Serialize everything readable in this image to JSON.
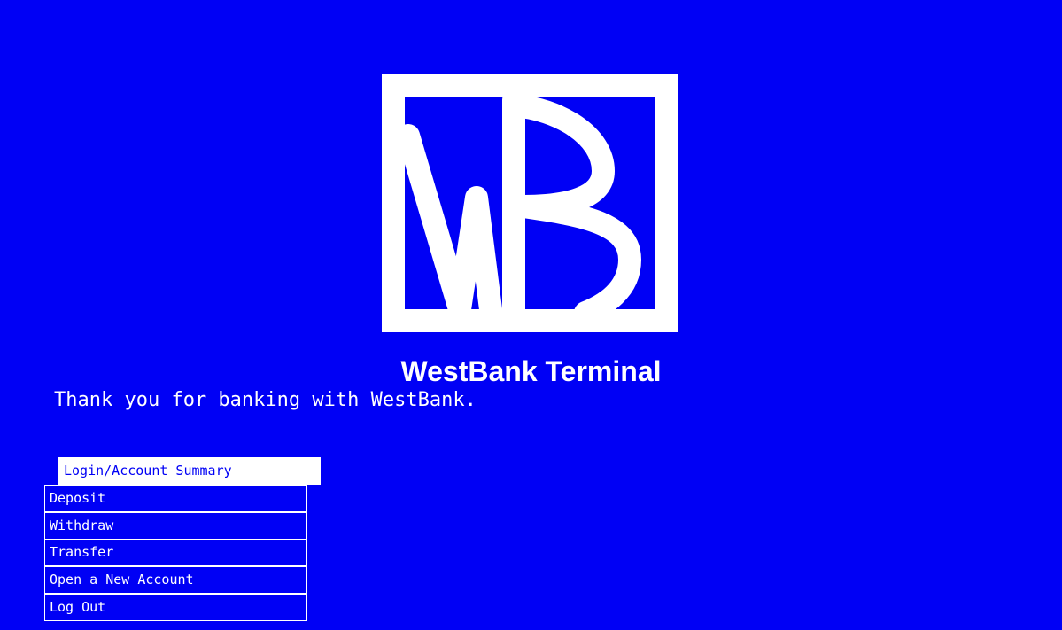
{
  "app": {
    "title": "WestBank Terminal",
    "message": "Thank you for banking with WestBank."
  },
  "logo": {
    "icon": "westbank-wb-logo"
  },
  "menu": {
    "selected_index": 0,
    "items": [
      {
        "label": "Login/Account Summary"
      },
      {
        "label": "Deposit"
      },
      {
        "label": "Withdraw"
      },
      {
        "label": "Transfer"
      },
      {
        "label": "Open a New Account"
      },
      {
        "label": "Log Out"
      }
    ]
  },
  "colors": {
    "background": "#0000f5",
    "foreground": "#ffffff"
  }
}
